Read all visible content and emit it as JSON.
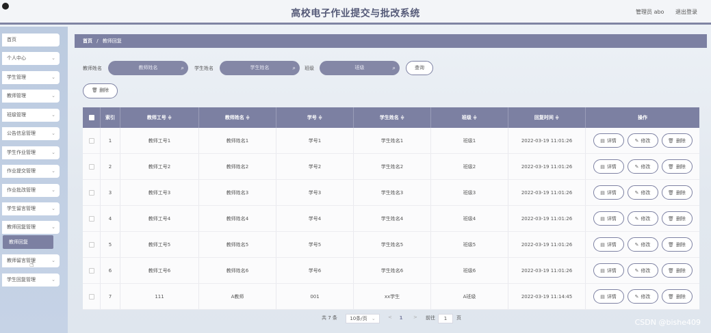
{
  "header": {
    "title": "高校电子作业提交与批改系统",
    "user": "管理员 abo",
    "logout": "退出登录"
  },
  "sidebar": {
    "items": [
      {
        "label": "首页",
        "chevron": false
      },
      {
        "label": "个人中心",
        "chevron": true
      },
      {
        "label": "学生管理",
        "chevron": true
      },
      {
        "label": "教师管理",
        "chevron": true
      },
      {
        "label": "班级管理",
        "chevron": true
      },
      {
        "label": "公告信息管理",
        "chevron": true
      },
      {
        "label": "学生作业管理",
        "chevron": true
      },
      {
        "label": "作业提交管理",
        "chevron": true
      },
      {
        "label": "作业批改管理",
        "chevron": true
      },
      {
        "label": "学生留言管理",
        "chevron": true
      },
      {
        "label": "教师回复管理",
        "chevron": true
      },
      {
        "label": "教师留言管理",
        "chevron": true
      },
      {
        "label": "学生回复管理",
        "chevron": true
      }
    ],
    "sub_active": "教师回复"
  },
  "breadcrumb": {
    "home": "首页",
    "sep": "/",
    "current": "教师回复"
  },
  "filters": {
    "teacher_label": "教师姓名",
    "teacher_placeholder": "教师姓名",
    "student_label": "学生姓名",
    "student_placeholder": "学生姓名",
    "class_label": "班级",
    "class_placeholder": "班级",
    "query_button": "查询",
    "delete_button": "删除"
  },
  "table": {
    "headers": {
      "index": "索引",
      "teacher_id": "教师工号 ≑",
      "teacher_name": "教师姓名 ≑",
      "student_id": "学号 ≑",
      "student_name": "学生姓名 ≑",
      "class": "班级 ≑",
      "reply_time": "回复时间 ≑",
      "actions": "操作"
    },
    "rows": [
      {
        "index": "1",
        "teacher_id": "教师工号1",
        "teacher_name": "教师姓名1",
        "student_id": "学号1",
        "student_name": "学生姓名1",
        "class": "班级1",
        "reply_time": "2022-03-19 11:01:26"
      },
      {
        "index": "2",
        "teacher_id": "教师工号2",
        "teacher_name": "教师姓名2",
        "student_id": "学号2",
        "student_name": "学生姓名2",
        "class": "班级2",
        "reply_time": "2022-03-19 11:01:26"
      },
      {
        "index": "3",
        "teacher_id": "教师工号3",
        "teacher_name": "教师姓名3",
        "student_id": "学号3",
        "student_name": "学生姓名3",
        "class": "班级3",
        "reply_time": "2022-03-19 11:01:26"
      },
      {
        "index": "4",
        "teacher_id": "教师工号4",
        "teacher_name": "教师姓名4",
        "student_id": "学号4",
        "student_name": "学生姓名4",
        "class": "班级4",
        "reply_time": "2022-03-19 11:01:26"
      },
      {
        "index": "5",
        "teacher_id": "教师工号5",
        "teacher_name": "教师姓名5",
        "student_id": "学号5",
        "student_name": "学生姓名5",
        "class": "班级5",
        "reply_time": "2022-03-19 11:01:26"
      },
      {
        "index": "6",
        "teacher_id": "教师工号6",
        "teacher_name": "教师姓名6",
        "student_id": "学号6",
        "student_name": "学生姓名6",
        "class": "班级6",
        "reply_time": "2022-03-19 11:01:26"
      },
      {
        "index": "7",
        "teacher_id": "111",
        "teacher_name": "A教师",
        "student_id": "001",
        "student_name": "xx学生",
        "class": "A班级",
        "reply_time": "2022-03-19 11:14:45"
      }
    ],
    "actions": {
      "detail": "详情",
      "edit": "修改",
      "delete": "删除"
    }
  },
  "pagination": {
    "total": "共 7 条",
    "page_size": "10条/页",
    "prev": "<",
    "current": "1",
    "next": ">",
    "goto_label": "前往",
    "goto_value": "1",
    "page_unit": "页"
  },
  "watermark": "CSDN @bishe409",
  "colors": {
    "accent": "#7c80a2",
    "sidebar": "#c3d0e3"
  }
}
